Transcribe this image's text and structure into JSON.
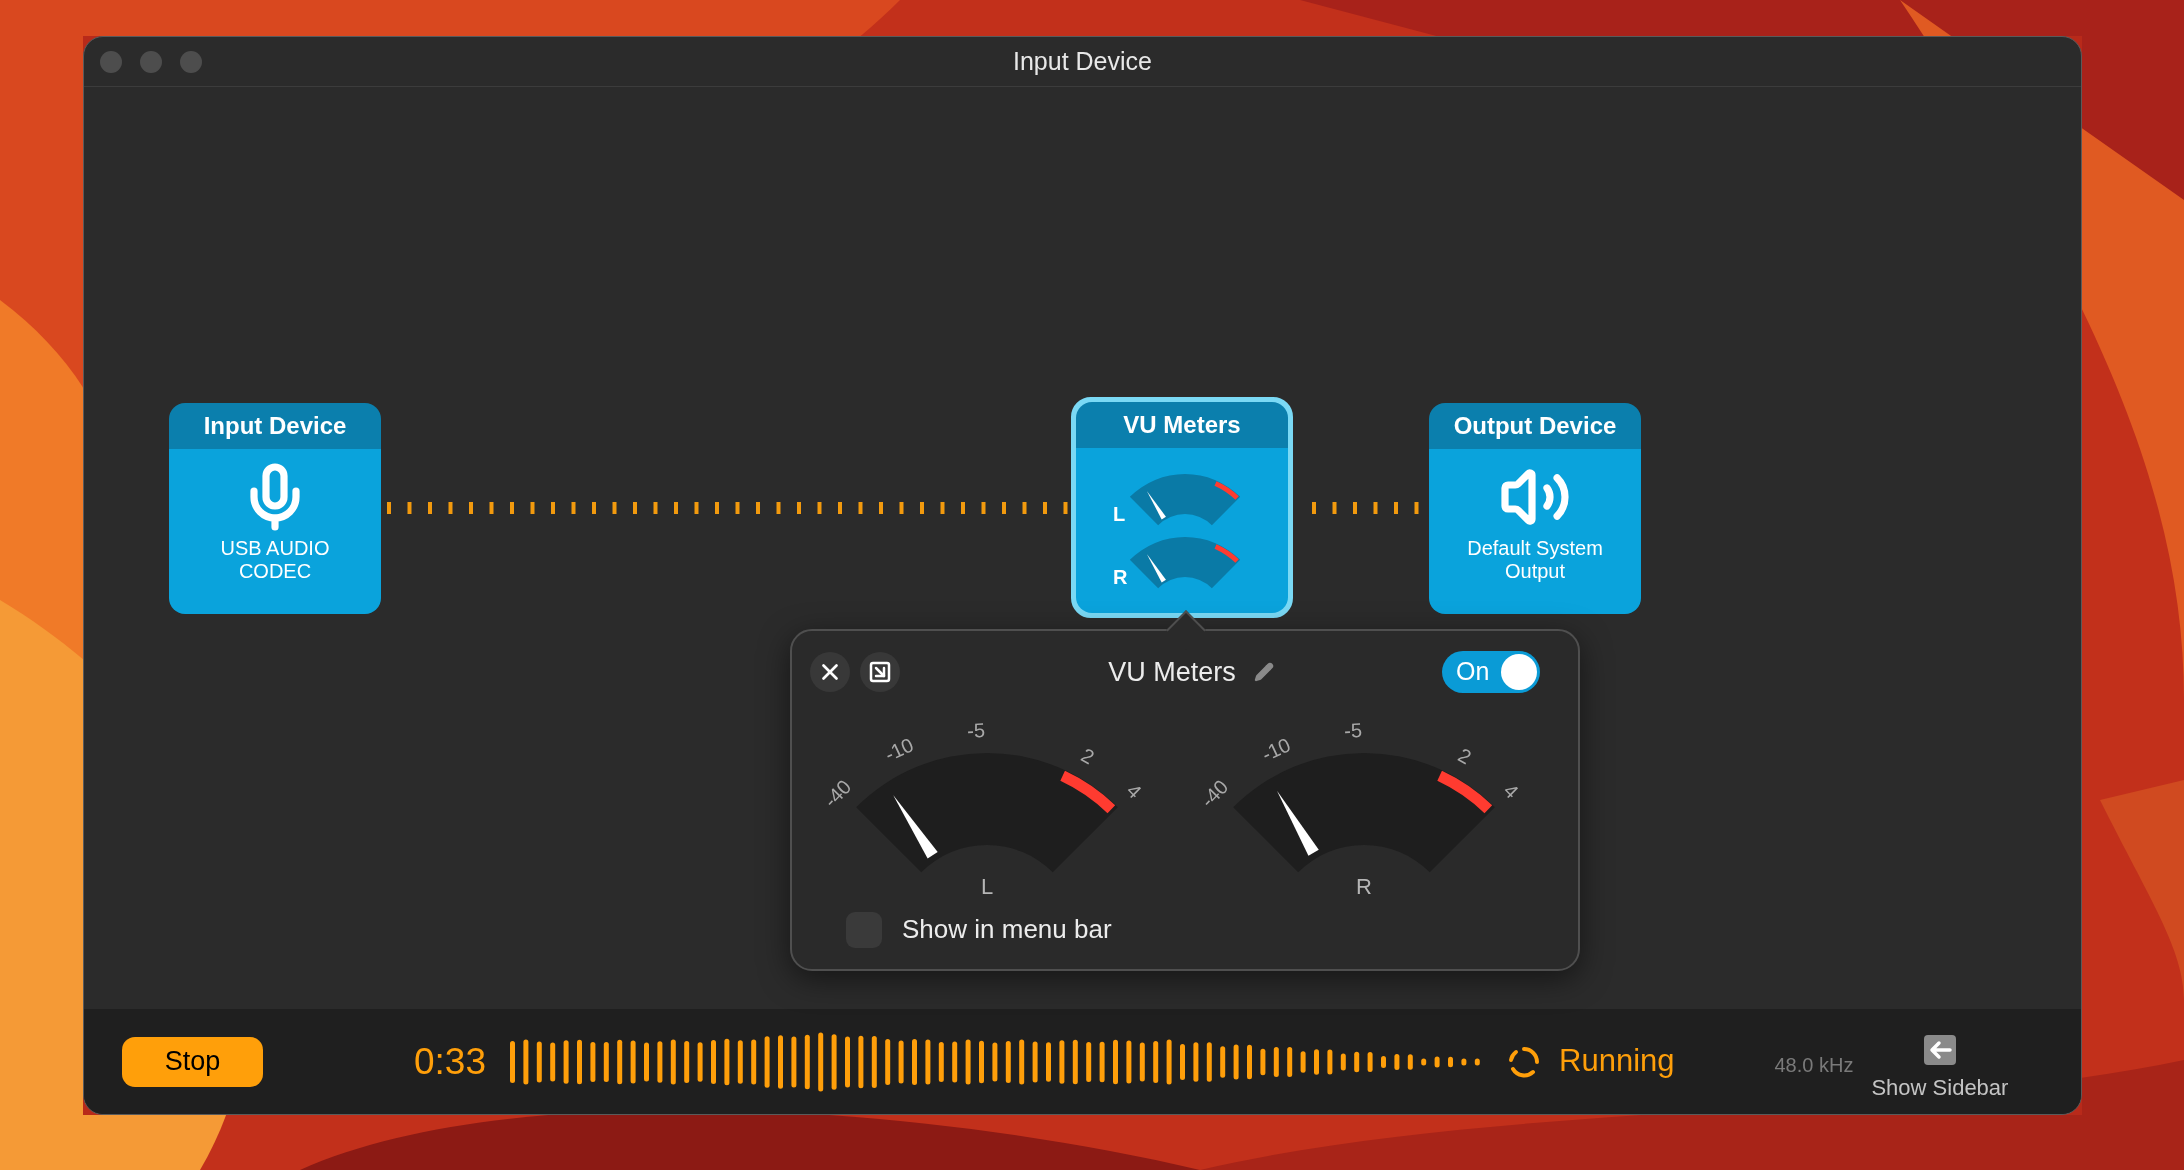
{
  "window": {
    "title": "Input Device"
  },
  "nodes": [
    {
      "kind": "input",
      "title": "Input Device",
      "label": "USB AUDIO CODEC",
      "selected": false
    },
    {
      "kind": "meters",
      "title": "VU Meters",
      "channels": [
        "L",
        "R"
      ],
      "selected": true
    },
    {
      "kind": "output",
      "title": "Output Device",
      "label": "Default System Output",
      "selected": false
    }
  ],
  "popover": {
    "title": "VU Meters",
    "toggle": {
      "label": "On",
      "on": true
    },
    "meters": [
      {
        "label": "L",
        "level": 0.13,
        "ticks": [
          "-40",
          "-10",
          "-5",
          "2",
          "4"
        ]
      },
      {
        "label": "R",
        "level": 0.16,
        "ticks": [
          "-40",
          "-10",
          "-5",
          "2",
          "4"
        ]
      }
    ],
    "show_in_menu_bar": {
      "label": "Show in menu bar",
      "checked": false
    }
  },
  "bottom_bar": {
    "stop_button": "Stop",
    "elapsed": "0:33",
    "status": "Running",
    "sample_rate": "48.0 kHz",
    "sidebar_button": "Show Sidebar"
  }
}
